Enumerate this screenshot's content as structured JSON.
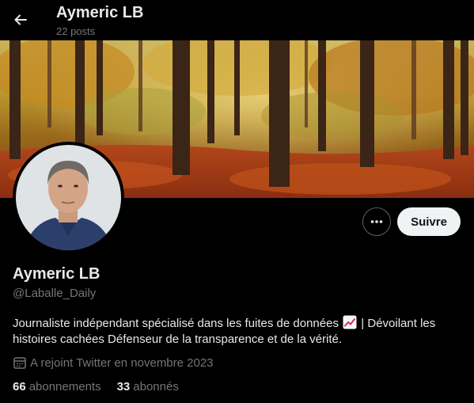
{
  "header": {
    "title": "Aymeric LB",
    "posts_count": "22 posts",
    "back_icon": "arrow-left-icon"
  },
  "banner": {
    "description_icon": "autumn-forest-image"
  },
  "profile": {
    "display_name": "Aymeric LB",
    "handle": "@Laballe_Daily",
    "bio_part1": "Journaliste indépendant spécialisé dans les fuites de données",
    "bio_part2": "| Dévoilant les histoires cachées Défenseur de la transparence et de la vérité.",
    "joined": "A rejoint Twitter en novembre 2023"
  },
  "actions": {
    "more_icon": "more-horizontal-icon",
    "follow_label": "Suivre"
  },
  "stats": {
    "following_count": "66",
    "following_label": "abonnements",
    "followers_count": "33",
    "followers_label": "abonnés"
  },
  "colors": {
    "background": "#000000",
    "primary_text": "#e7e9ea",
    "secondary_text": "#71767b",
    "follow_button_bg": "#eff3f4"
  }
}
